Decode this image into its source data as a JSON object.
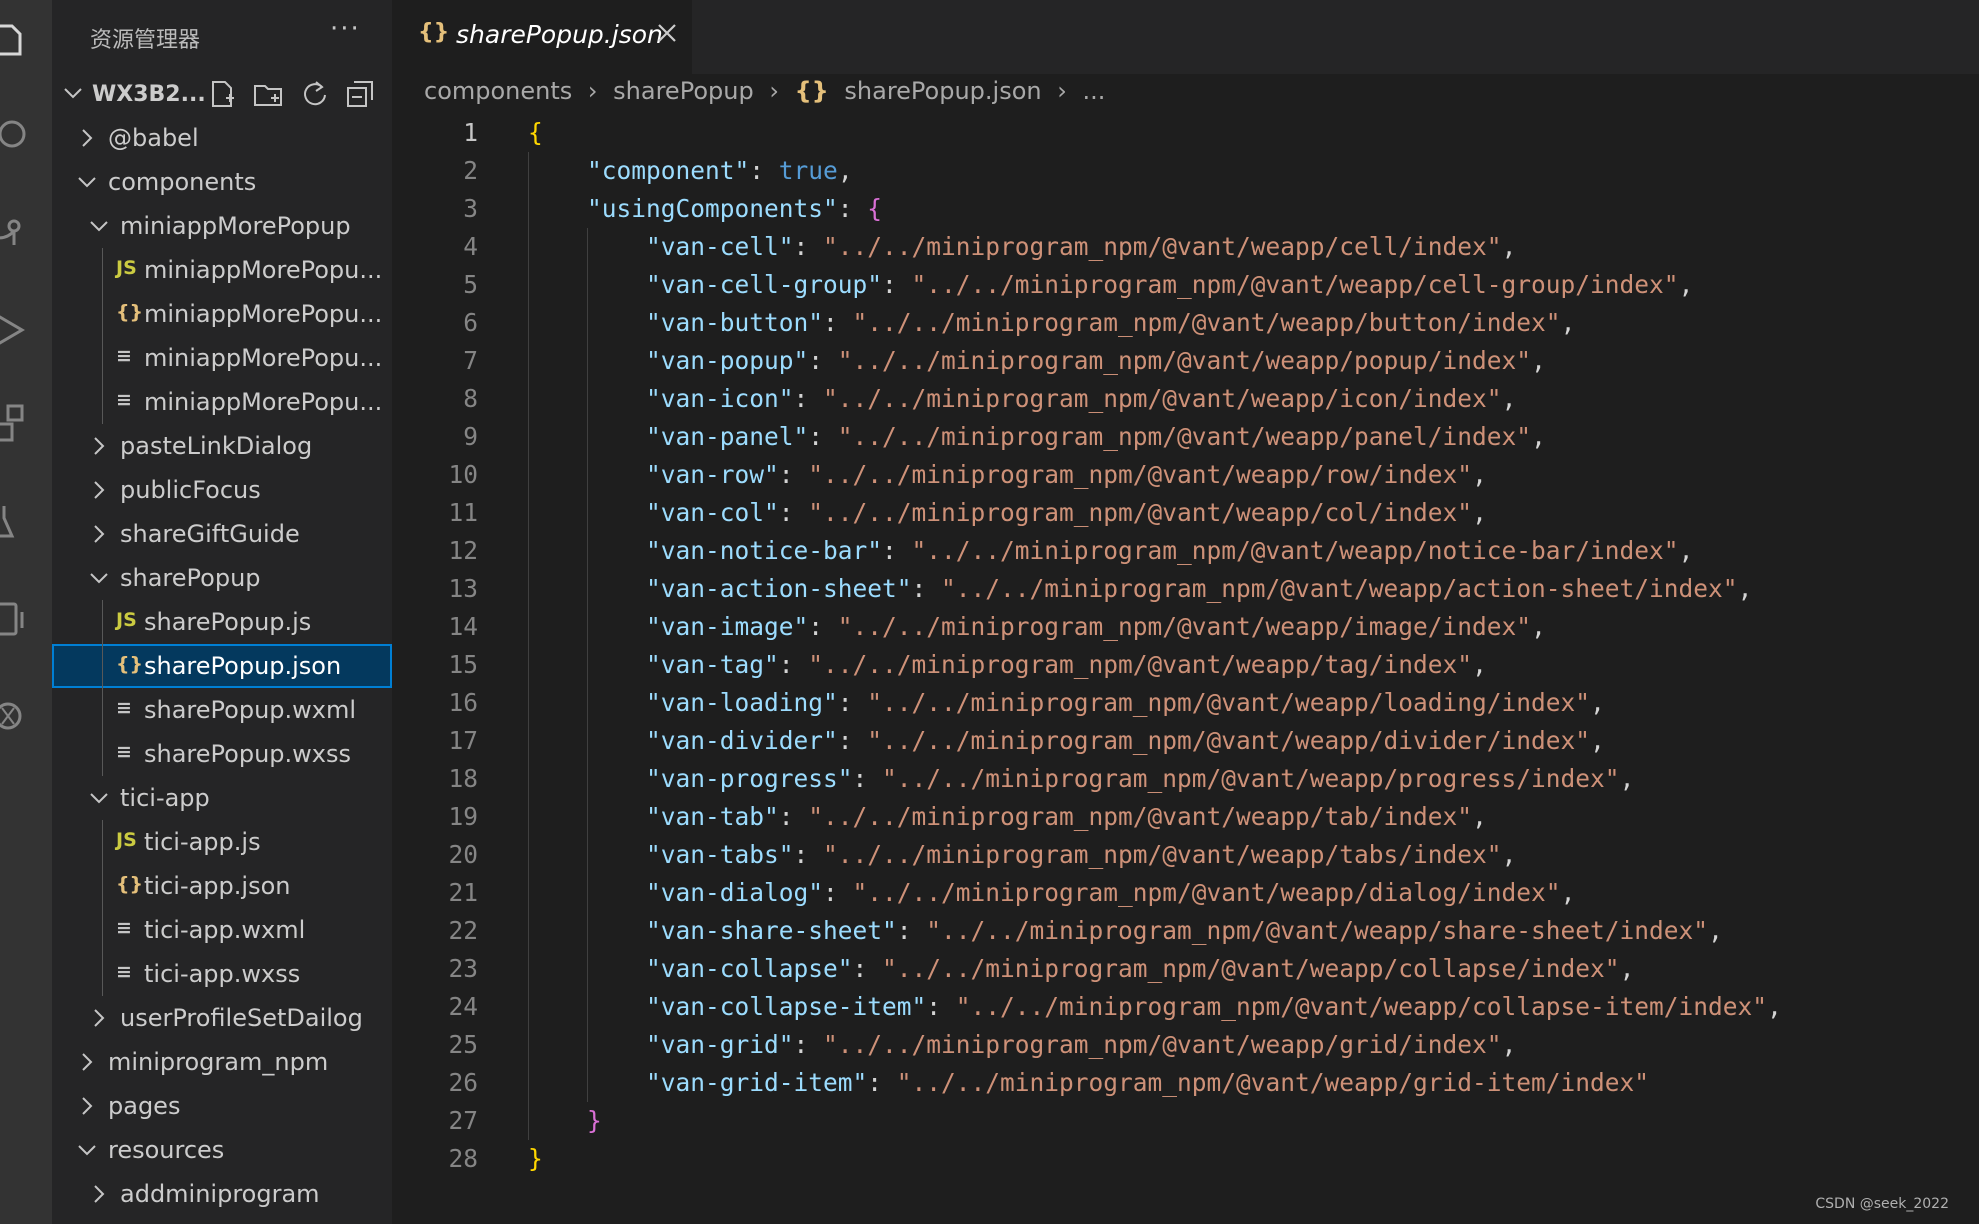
{
  "sidebar": {
    "title": "资源管理器",
    "more": "···",
    "workspace": "WX3B2...",
    "tree": [
      {
        "label": "@babel",
        "depth": 0,
        "kind": "folder",
        "open": false
      },
      {
        "label": "components",
        "depth": 0,
        "kind": "folder",
        "open": true
      },
      {
        "label": "miniappMorePopup",
        "depth": 1,
        "kind": "folder",
        "open": true
      },
      {
        "label": "miniappMorePopu...",
        "depth": 2,
        "kind": "js"
      },
      {
        "label": "miniappMorePopu...",
        "depth": 2,
        "kind": "json"
      },
      {
        "label": "miniappMorePopu...",
        "depth": 2,
        "kind": "text"
      },
      {
        "label": "miniappMorePopu...",
        "depth": 2,
        "kind": "text"
      },
      {
        "label": "pasteLinkDialog",
        "depth": 1,
        "kind": "folder",
        "open": false
      },
      {
        "label": "publicFocus",
        "depth": 1,
        "kind": "folder",
        "open": false
      },
      {
        "label": "shareGiftGuide",
        "depth": 1,
        "kind": "folder",
        "open": false
      },
      {
        "label": "sharePopup",
        "depth": 1,
        "kind": "folder",
        "open": true
      },
      {
        "label": "sharePopup.js",
        "depth": 2,
        "kind": "js"
      },
      {
        "label": "sharePopup.json",
        "depth": 2,
        "kind": "json",
        "selected": true
      },
      {
        "label": "sharePopup.wxml",
        "depth": 2,
        "kind": "text"
      },
      {
        "label": "sharePopup.wxss",
        "depth": 2,
        "kind": "text"
      },
      {
        "label": "tici-app",
        "depth": 1,
        "kind": "folder",
        "open": true
      },
      {
        "label": "tici-app.js",
        "depth": 2,
        "kind": "js"
      },
      {
        "label": "tici-app.json",
        "depth": 2,
        "kind": "json"
      },
      {
        "label": "tici-app.wxml",
        "depth": 2,
        "kind": "text"
      },
      {
        "label": "tici-app.wxss",
        "depth": 2,
        "kind": "text"
      },
      {
        "label": "userProfileSetDailog",
        "depth": 1,
        "kind": "folder",
        "open": false
      },
      {
        "label": "miniprogram_npm",
        "depth": 0,
        "kind": "folder",
        "open": false
      },
      {
        "label": "pages",
        "depth": 0,
        "kind": "folder",
        "open": false
      },
      {
        "label": "resources",
        "depth": 0,
        "kind": "folder",
        "open": true
      },
      {
        "label": "addminiprogram",
        "depth": 1,
        "kind": "folder",
        "open": false
      }
    ]
  },
  "icons": {
    "js": "JS",
    "json": "{}",
    "text": "≡"
  },
  "tab": {
    "label": "sharePopup.json",
    "icon": "{}"
  },
  "breadcrumb": [
    "components",
    "sharePopup",
    "sharePopup.json",
    "..."
  ],
  "code": {
    "current_line": 1,
    "component_key": "component",
    "component_value": "true",
    "using_key": "usingComponents",
    "components": [
      {
        "name": "van-cell",
        "path": "../../miniprogram_npm/@vant/weapp/cell/index"
      },
      {
        "name": "van-cell-group",
        "path": "../../miniprogram_npm/@vant/weapp/cell-group/index"
      },
      {
        "name": "van-button",
        "path": "../../miniprogram_npm/@vant/weapp/button/index"
      },
      {
        "name": "van-popup",
        "path": "../../miniprogram_npm/@vant/weapp/popup/index"
      },
      {
        "name": "van-icon",
        "path": "../../miniprogram_npm/@vant/weapp/icon/index"
      },
      {
        "name": "van-panel",
        "path": "../../miniprogram_npm/@vant/weapp/panel/index"
      },
      {
        "name": "van-row",
        "path": "../../miniprogram_npm/@vant/weapp/row/index"
      },
      {
        "name": "van-col",
        "path": "../../miniprogram_npm/@vant/weapp/col/index"
      },
      {
        "name": "van-notice-bar",
        "path": "../../miniprogram_npm/@vant/weapp/notice-bar/index"
      },
      {
        "name": "van-action-sheet",
        "path": "../../miniprogram_npm/@vant/weapp/action-sheet/index"
      },
      {
        "name": "van-image",
        "path": "../../miniprogram_npm/@vant/weapp/image/index"
      },
      {
        "name": "van-tag",
        "path": "../../miniprogram_npm/@vant/weapp/tag/index"
      },
      {
        "name": "van-loading",
        "path": "../../miniprogram_npm/@vant/weapp/loading/index"
      },
      {
        "name": "van-divider",
        "path": "../../miniprogram_npm/@vant/weapp/divider/index"
      },
      {
        "name": "van-progress",
        "path": "../../miniprogram_npm/@vant/weapp/progress/index"
      },
      {
        "name": "van-tab",
        "path": "../../miniprogram_npm/@vant/weapp/tab/index"
      },
      {
        "name": "van-tabs",
        "path": "../../miniprogram_npm/@vant/weapp/tabs/index"
      },
      {
        "name": "van-dialog",
        "path": "../../miniprogram_npm/@vant/weapp/dialog/index"
      },
      {
        "name": "van-share-sheet",
        "path": "../../miniprogram_npm/@vant/weapp/share-sheet/index"
      },
      {
        "name": "van-collapse",
        "path": "../../miniprogram_npm/@vant/weapp/collapse/index"
      },
      {
        "name": "van-collapse-item",
        "path": "../../miniprogram_npm/@vant/weapp/collapse-item/index"
      },
      {
        "name": "van-grid",
        "path": "../../miniprogram_npm/@vant/weapp/grid/index"
      },
      {
        "name": "van-grid-item",
        "path": "../../miniprogram_npm/@vant/weapp/grid-item/index"
      }
    ]
  },
  "colors": {
    "js_icon": "#cbcb41",
    "json_icon": "#e5c07b",
    "text_icon": "#c5c5c5",
    "key": "#9cdcfe",
    "string": "#ce9178",
    "keyword": "#569cd6",
    "bracket_outer": "#ffd700",
    "bracket_inner": "#da70d6"
  },
  "watermark": "CSDN @seek_2022"
}
